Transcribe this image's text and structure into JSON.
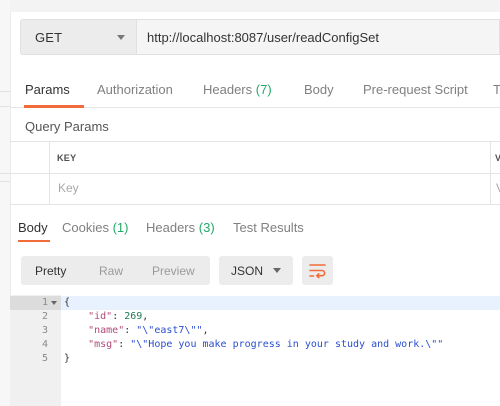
{
  "request": {
    "method": "GET",
    "url": "http://localhost:8087/user/readConfigSet"
  },
  "request_tabs": [
    {
      "label": "Params",
      "count": "",
      "active": true
    },
    {
      "label": "Authorization",
      "count": ""
    },
    {
      "label": "Headers",
      "count": "(7)"
    },
    {
      "label": "Body",
      "count": ""
    },
    {
      "label": "Pre-request Script",
      "count": ""
    },
    {
      "label": "T",
      "count": ""
    }
  ],
  "query_params": {
    "title": "Query Params",
    "columns": [
      "KEY",
      "V"
    ],
    "placeholders": {
      "key": "Key",
      "value": "V"
    }
  },
  "response_tabs": [
    {
      "label": "Body",
      "count": "",
      "active": true
    },
    {
      "label": "Cookies",
      "count": "(1)"
    },
    {
      "label": "Headers",
      "count": "(3)"
    },
    {
      "label": "Test Results",
      "count": ""
    }
  ],
  "view_controls": {
    "modes": [
      "Pretty",
      "Raw",
      "Preview"
    ],
    "active_mode": "Pretty",
    "format": "JSON",
    "wrap_icon": "text-wrap-icon"
  },
  "response_body": {
    "line_numbers": [
      "1",
      "2",
      "3",
      "4",
      "5"
    ],
    "lines": [
      {
        "parts": [
          {
            "t": "p",
            "v": "{"
          }
        ]
      },
      {
        "parts": [
          {
            "t": "p",
            "v": "    "
          },
          {
            "t": "k",
            "v": "\"id\""
          },
          {
            "t": "p",
            "v": ": "
          },
          {
            "t": "n",
            "v": "269"
          },
          {
            "t": "p",
            "v": ","
          }
        ]
      },
      {
        "parts": [
          {
            "t": "p",
            "v": "    "
          },
          {
            "t": "k",
            "v": "\"name\""
          },
          {
            "t": "p",
            "v": ": "
          },
          {
            "t": "s",
            "v": "\"\\\"east7\\\"\""
          },
          {
            "t": "p",
            "v": ","
          }
        ]
      },
      {
        "parts": [
          {
            "t": "p",
            "v": "    "
          },
          {
            "t": "k",
            "v": "\"msg\""
          },
          {
            "t": "p",
            "v": ": "
          },
          {
            "t": "s",
            "v": "\"\\\"Hope you make progress in your study and work.\\\"\""
          }
        ]
      },
      {
        "parts": [
          {
            "t": "p",
            "v": "}"
          }
        ]
      }
    ]
  },
  "colors": {
    "accent": "#f26b3a",
    "count_green": "#25a96a",
    "json_key": "#b04a7a",
    "json_number": "#1e7a57",
    "json_string": "#2a4fd0"
  }
}
